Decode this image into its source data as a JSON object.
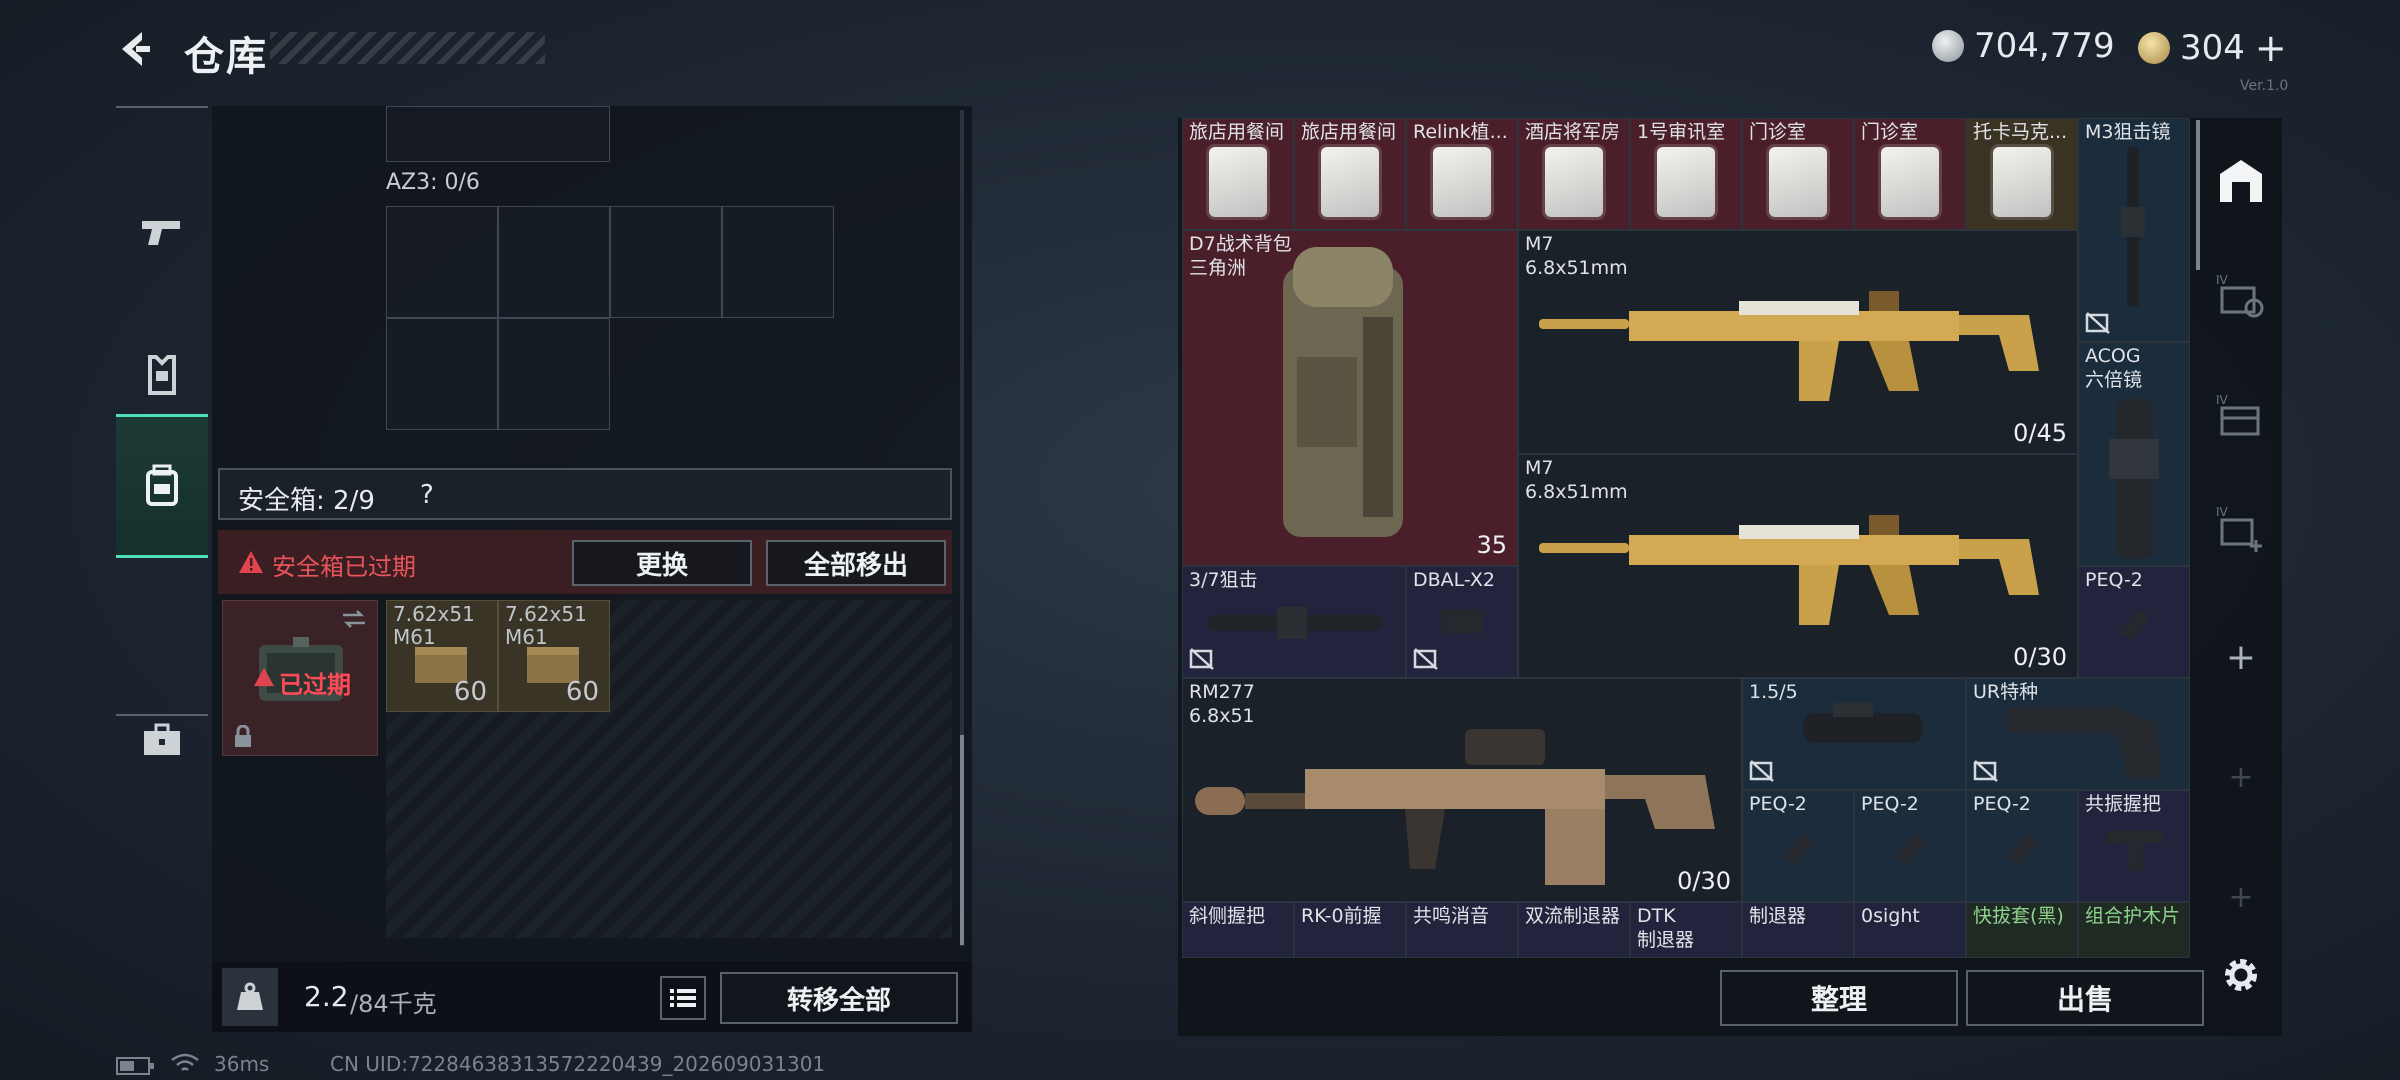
{
  "header": {
    "title": "仓库",
    "silver": "704,779",
    "gold": "304",
    "gold_plus": "+",
    "version": "Ver.1.0"
  },
  "nav": {
    "items": [
      "weapons",
      "armor",
      "backpack",
      "toolbox"
    ],
    "active": 2
  },
  "left": {
    "az3_label": "AZ3: 0/6",
    "safebox_label": "安全箱: 2/9",
    "help": "?",
    "expired_warning": "安全箱已过期",
    "replace": "更换",
    "remove_all": "全部移出",
    "case_badge": "已过期",
    "ammo": [
      {
        "name": "7.62x51",
        "sub": "M61",
        "count": "60"
      },
      {
        "name": "7.62x51",
        "sub": "M61",
        "count": "60"
      }
    ],
    "weight": "2.2",
    "weight_max": "/84千克",
    "transfer_all": "转移全部"
  },
  "inventory": {
    "top_row": [
      "旅店用餐间",
      "旅店用餐间",
      "Relink植...",
      "酒店将军房",
      "1号审讯室",
      "门诊室",
      "门诊室",
      "托卡马克...",
      "M3狙击镜"
    ],
    "backpack": {
      "name": "D7战术背包",
      "sub": "三角洲",
      "count": "35"
    },
    "m7a": {
      "name": "M7",
      "sub": "6.8x51mm",
      "ammo": "0/45"
    },
    "m7b": {
      "name": "M7",
      "sub": "6.8x51mm",
      "ammo": "0/30"
    },
    "acog": {
      "name": "ACOG",
      "sub": "六倍镜"
    },
    "scope37": "3/7狙击",
    "dbal": "DBAL-X2",
    "peq_right": "PEQ-2",
    "rm277": {
      "name": "RM277",
      "sub": "6.8x51",
      "ammo": "0/30"
    },
    "scope15": "1.5/5",
    "ur": "UR特种",
    "peq_row": [
      "PEQ-2",
      "PEQ-2",
      "PEQ-2",
      "共振握把"
    ],
    "bottom_row": [
      "斜侧握把",
      "RK-0前握",
      "共鸣消音",
      "双流制退器",
      "DTK",
      "制退器",
      "0sight",
      "快拔套(黑)",
      "组合护木片"
    ],
    "dtk_sub": "制退器",
    "organize": "整理",
    "sell": "出售"
  },
  "status": {
    "ping": "36ms",
    "uid": "CN UID:72284638313572220439_202609031301"
  },
  "colors": {
    "accent": "#4fe0b8",
    "danger": "#e0454f",
    "red_cell": "#4b1f2a",
    "blue_cell": "#1b2c3d"
  }
}
